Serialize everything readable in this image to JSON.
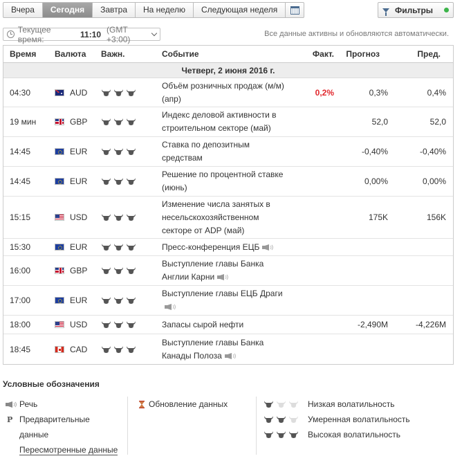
{
  "tabs": [
    {
      "label": "Вчера",
      "active": false
    },
    {
      "label": "Сегодня",
      "active": true
    },
    {
      "label": "Завтра",
      "active": false
    },
    {
      "label": "На неделю",
      "active": false
    },
    {
      "label": "Следующая неделя",
      "active": false
    }
  ],
  "filters": {
    "label": "Фильтры",
    "status_color": "#3cb44a"
  },
  "time": {
    "label": "Текущее время:",
    "value": "11:10",
    "tz": "(GMT +3:00)"
  },
  "auto_note": "Все данные активны и обновляются автоматически.",
  "columns": {
    "time": "Время",
    "currency": "Валюта",
    "importance": "Важн.",
    "event": "Событие",
    "actual": "Факт.",
    "forecast": "Прогноз",
    "previous": "Пред."
  },
  "date_header": "Четверг, 2 июня 2016 г.",
  "events": [
    {
      "time": "04:30",
      "flag": "au",
      "currency": "AUD",
      "importance": 3,
      "event": "Объём розничных продаж (м/м) (апр)",
      "speech": false,
      "actual": "0,2%",
      "actual_color": "#e1272d",
      "forecast": "0,3%",
      "previous": "0,4%"
    },
    {
      "time": "19 мин",
      "flag": "gb",
      "currency": "GBP",
      "importance": 3,
      "event": "Индекс деловой активности в строительном секторе (май)",
      "speech": false,
      "actual": "",
      "forecast": "52,0",
      "previous": "52,0"
    },
    {
      "time": "14:45",
      "flag": "eu",
      "currency": "EUR",
      "importance": 3,
      "event": "Ставка по депозитным средствам",
      "speech": false,
      "actual": "",
      "forecast": "-0,40%",
      "previous": "-0,40%"
    },
    {
      "time": "14:45",
      "flag": "eu",
      "currency": "EUR",
      "importance": 3,
      "event": "Решение по процентной ставке (июнь)",
      "speech": false,
      "actual": "",
      "forecast": "0,00%",
      "previous": "0,00%"
    },
    {
      "time": "15:15",
      "flag": "us",
      "currency": "USD",
      "importance": 3,
      "event": "Изменение числа занятых в несельскохозяйственном секторе от ADP (май)",
      "speech": false,
      "actual": "",
      "forecast": "175K",
      "previous": "156K"
    },
    {
      "time": "15:30",
      "flag": "eu",
      "currency": "EUR",
      "importance": 3,
      "event": "Пресс-конференция ЕЦБ",
      "speech": true,
      "actual": "",
      "forecast": "",
      "previous": ""
    },
    {
      "time": "16:00",
      "flag": "gb",
      "currency": "GBP",
      "importance": 3,
      "event": "Выступление главы Банка Англии Карни",
      "speech": true,
      "actual": "",
      "forecast": "",
      "previous": ""
    },
    {
      "time": "17:00",
      "flag": "eu",
      "currency": "EUR",
      "importance": 3,
      "event": "Выступление главы ЕЦБ Драги",
      "speech": true,
      "actual": "",
      "forecast": "",
      "previous": ""
    },
    {
      "time": "18:00",
      "flag": "us",
      "currency": "USD",
      "importance": 3,
      "event": "Запасы сырой нефти",
      "speech": false,
      "actual": "",
      "forecast": "-2,490M",
      "previous": "-4,226M"
    },
    {
      "time": "18:45",
      "flag": "ca",
      "currency": "CAD",
      "importance": 3,
      "event": "Выступление главы Банка Канады Полоза",
      "speech": true,
      "actual": "",
      "forecast": "",
      "previous": ""
    }
  ],
  "legend": {
    "title": "Условные обозначения",
    "speech": "Речь",
    "preliminary_line1": "Предварительные",
    "preliminary_line2": "данные",
    "revised": "Пересмотренные данные",
    "update": "Обновление данных",
    "low": "Низкая волатильность",
    "medium": "Умеренная волатильность",
    "high": "Высокая волатильность"
  },
  "colors": {
    "bull_on": "#555555",
    "bull_off": "#dddddd",
    "active_tab": "#999999"
  }
}
